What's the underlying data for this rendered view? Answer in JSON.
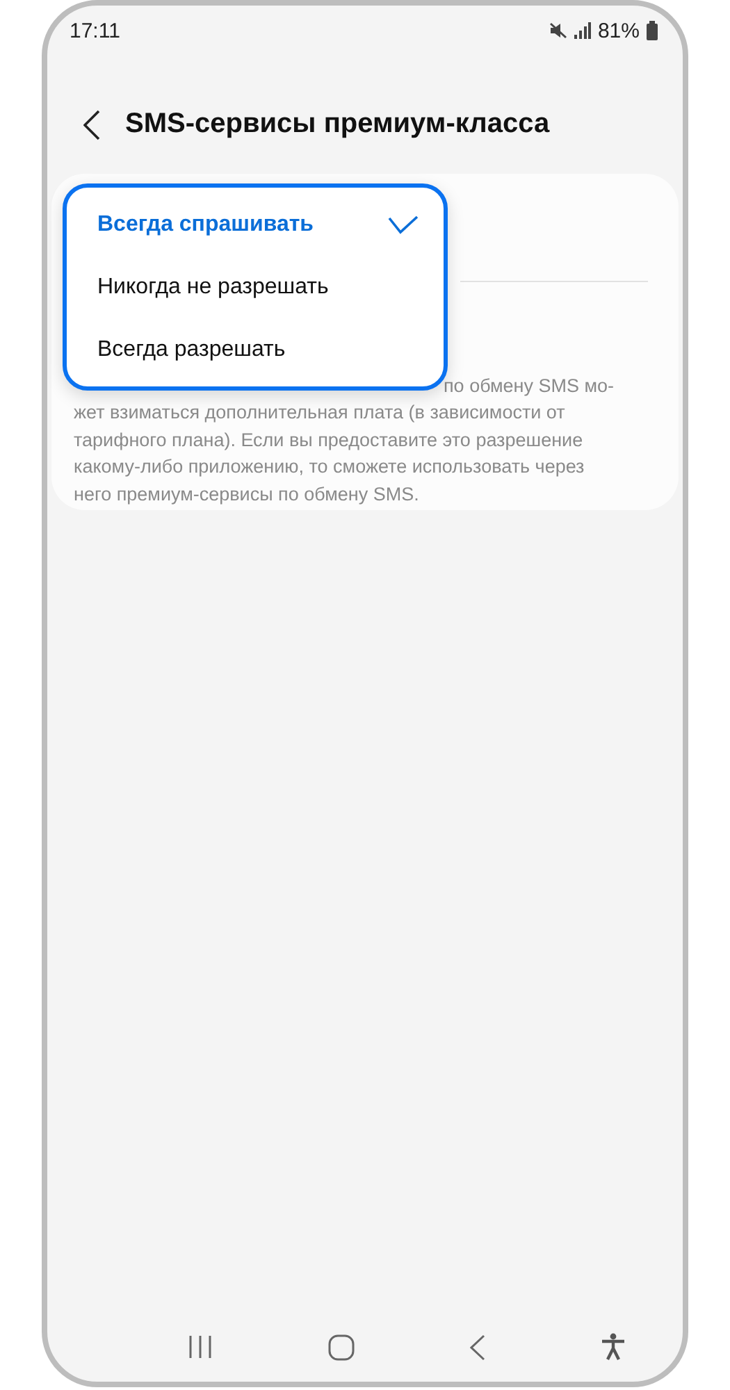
{
  "status_bar": {
    "time": "17:11",
    "battery": "81%"
  },
  "header": {
    "title": "SMS-сервисы премиум-класса"
  },
  "description_lines": [
    "по обмену SMS мо-",
    "жет взиматься дополнительная плата (в зависимости от",
    "тарифного плана). Если вы предоставите это разрешение",
    "какому-либо приложению, то сможете использовать через",
    "него премиум-сервисы по обмену SMS."
  ],
  "menu": [
    {
      "label": "Всегда спрашивать",
      "selected": true
    },
    {
      "label": "Никогда не разрешать",
      "selected": false
    },
    {
      "label": "Всегда разрешать",
      "selected": false
    }
  ]
}
